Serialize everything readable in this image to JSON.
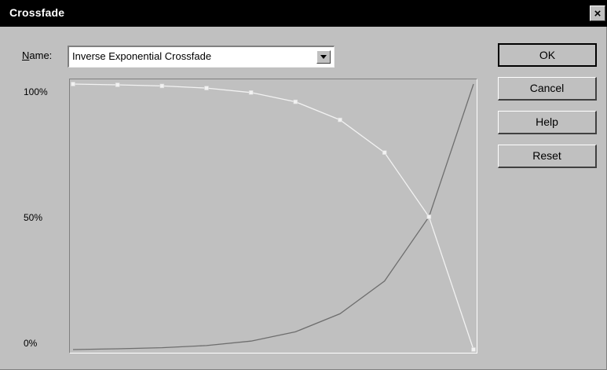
{
  "window": {
    "title": "Crossfade",
    "close_glyph": "×"
  },
  "name_field": {
    "label_prefix": "N",
    "label_rest": "ame:",
    "value": "Inverse Exponential Crossfade"
  },
  "buttons": {
    "ok": "OK",
    "cancel": "Cancel",
    "help": "Help",
    "reset": "Reset"
  },
  "graph": {
    "y_ticks": [
      "100%",
      "50%",
      "0%"
    ],
    "colors": {
      "fade_out": "#f2f2f2",
      "fade_in": "#6e6e6e"
    },
    "icons": [
      "close-icon",
      "dropdown-arrow-icon"
    ]
  },
  "chart_data": {
    "type": "line",
    "x": [
      0,
      1,
      2,
      3,
      4,
      5,
      6,
      7,
      8,
      9
    ],
    "ylim": [
      0,
      100
    ],
    "yticks": [
      "100%",
      "50%",
      "0%"
    ],
    "series": [
      {
        "key": "fade_out",
        "values": [
          100,
          99.7,
          99.3,
          98.5,
          96.8,
          93.3,
          86.5,
          74.2,
          50.0,
          0
        ]
      },
      {
        "key": "fade_in",
        "values": [
          0,
          0.3,
          0.7,
          1.5,
          3.2,
          6.7,
          13.5,
          25.8,
          50.0,
          100
        ]
      }
    ]
  }
}
